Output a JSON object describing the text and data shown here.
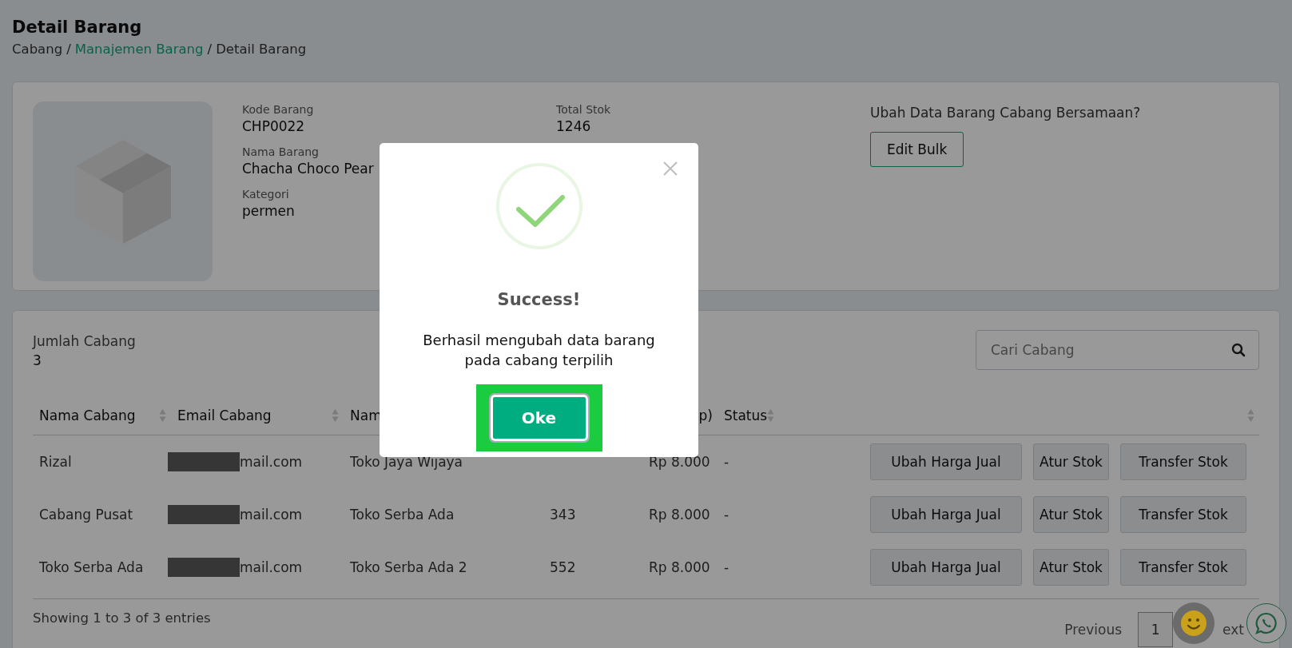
{
  "page": {
    "title": "Detail Barang",
    "separator": "/",
    "breadcrumb": [
      {
        "label": "Cabang",
        "link": false
      },
      {
        "label": "Manajemen Barang",
        "link": true
      },
      {
        "label": "Detail Barang",
        "link": false
      }
    ]
  },
  "product": {
    "left_fields": [
      {
        "label": "Kode Barang",
        "value": "CHP0022"
      },
      {
        "label": "Nama Barang",
        "value": "Chacha Choco Pear"
      },
      {
        "label": "Kategori",
        "value": "permen"
      }
    ],
    "right_fields": [
      {
        "label": "Total Stok",
        "value": "1246"
      }
    ],
    "bulk_prompt": "Ubah Data Barang Cabang Bersamaan?",
    "bulk_button": "Edit Bulk"
  },
  "branches": {
    "count_label": "Jumlah Cabang",
    "count": "3",
    "search": {
      "placeholder": "Cari Cabang"
    },
    "columns": [
      {
        "label": "Nama Cabang",
        "sortable": true
      },
      {
        "label": "Email Cabang",
        "sortable": true
      },
      {
        "label": "Nam"
      },
      {},
      {
        "label": "p)"
      },
      {
        "label": "Status",
        "sortable": true
      },
      {
        "sortable": true
      }
    ],
    "rows": [
      {
        "name": "Rizal",
        "email": "mail.com",
        "store": "Toko Jaya Wijaya",
        "price": "Rp 8.000",
        "status": "-",
        "actions": [
          "Ubah Harga Jual",
          "Atur Stok",
          "Transfer Stok"
        ]
      },
      {
        "name": "Cabang Pusat",
        "email": "mail.com",
        "store": "Toko Serba Ada",
        "stock": "343",
        "price": "Rp 8.000",
        "status": "-",
        "actions": [
          "Ubah Harga Jual",
          "Atur Stok",
          "Transfer Stok"
        ]
      },
      {
        "name": "Toko Serba Ada",
        "email": "mail.com",
        "store": "Toko Serba Ada 2",
        "stock": "552",
        "price": "Rp 8.000",
        "status": "-",
        "actions": [
          "Ubah Harga Jual",
          "Atur Stok",
          "Transfer Stok"
        ]
      }
    ],
    "info": "Showing 1 to 3 of 3 entries",
    "previous": "Previous",
    "pages": [
      {
        "label": "1",
        "selected": true
      }
    ],
    "next": "ext"
  },
  "modal": {
    "title": "Success!",
    "message": "Berhasil mengubah data barang pada cabang terpilih",
    "button": "Oke",
    "highlighted": true
  }
}
